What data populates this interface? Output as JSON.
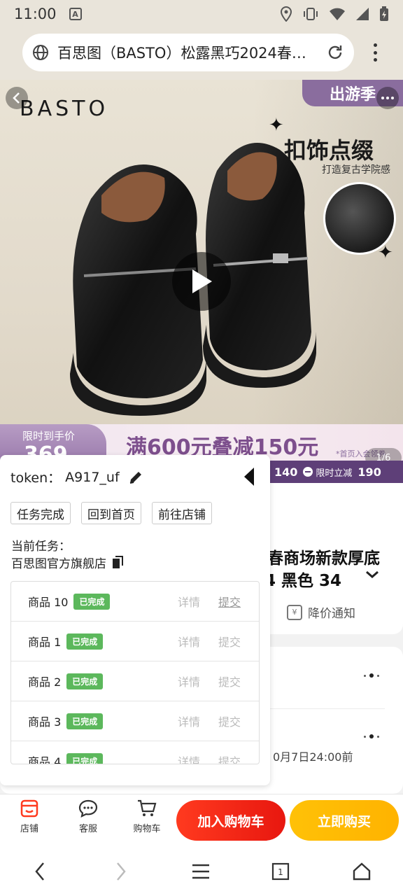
{
  "status_bar": {
    "time": "11:00"
  },
  "browser": {
    "url_text": "百思图（BASTO）松露黑巧2024春…"
  },
  "hero": {
    "brand": "BASTO",
    "top_tag": "出游季",
    "headline": "扣饰点缀",
    "subline": "打造复古学院感",
    "promo_left_label": "限时到手价",
    "promo_left_price": "369",
    "promo_main": "满600元叠减150元",
    "promo_note": "*首页入会领券",
    "counter": "1/6",
    "strip_price": "140",
    "strip_tag": "限时立减",
    "strip_value": "190"
  },
  "product": {
    "title_line1": "春商场新款厚底",
    "title_line2": "4 黑色 34",
    "price_alert": "降价通知",
    "deadline": "0月7日24:00前"
  },
  "panel": {
    "token_label": "token：",
    "token_value": "A917_uf",
    "buttons": [
      "任务完成",
      "回到首页",
      "前往店铺"
    ],
    "task_label": "当前任务：",
    "task_name": "百思图官方旗舰店",
    "items": [
      {
        "name": "商品 10",
        "status": "已完成",
        "detail": "详情",
        "submit": "提交"
      },
      {
        "name": "商品 1",
        "status": "已完成",
        "detail": "详情",
        "submit": "提交"
      },
      {
        "name": "商品 2",
        "status": "已完成",
        "detail": "详情",
        "submit": "提交"
      },
      {
        "name": "商品 3",
        "status": "已完成",
        "detail": "详情",
        "submit": "提交"
      },
      {
        "name": "商品 4",
        "status": "已完成",
        "detail": "详情",
        "submit": "提交"
      }
    ]
  },
  "action_bar": {
    "store": "店铺",
    "service": "客服",
    "cart": "购物车",
    "add_to_cart": "加入购物车",
    "buy_now": "立即购买"
  },
  "colors": {
    "accent_red": "#e8170f",
    "accent_yellow": "#ffb300",
    "badge_green": "#5cb85c",
    "promo_purple": "#8a6d9e"
  }
}
